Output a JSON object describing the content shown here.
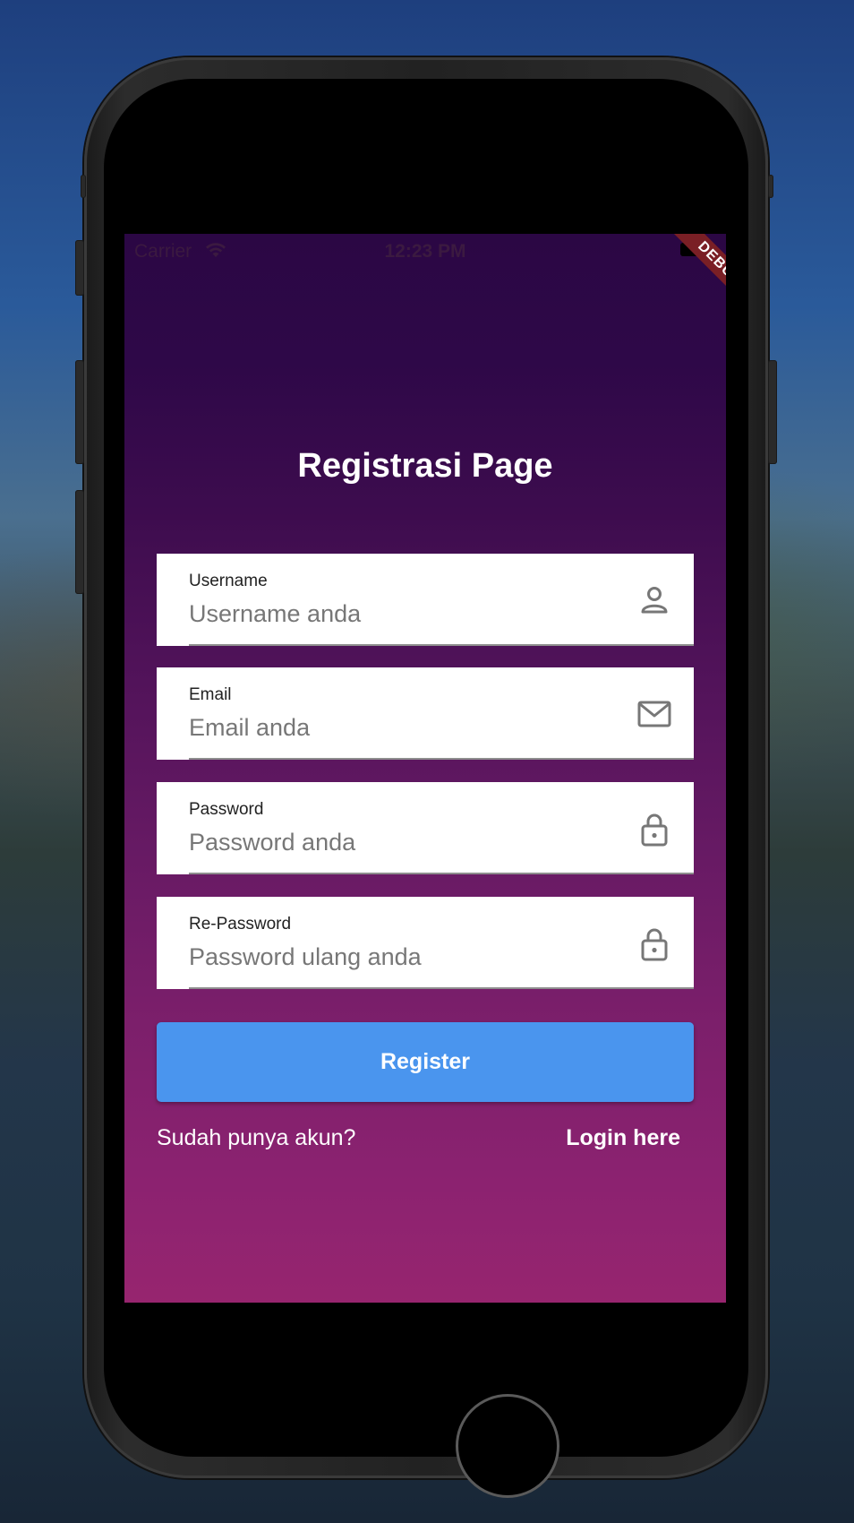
{
  "status_bar": {
    "carrier": "Carrier",
    "time": "12:23 PM"
  },
  "debug_banner": "DEBUG",
  "page": {
    "title": "Registrasi Page"
  },
  "form": {
    "fields": [
      {
        "label": "Username",
        "placeholder": "Username anda",
        "icon": "person-icon"
      },
      {
        "label": "Email",
        "placeholder": "Email anda",
        "icon": "mail-icon"
      },
      {
        "label": "Password",
        "placeholder": "Password anda",
        "icon": "lock-icon"
      },
      {
        "label": "Re-Password",
        "placeholder": "Password ulang anda",
        "icon": "lock-icon"
      }
    ],
    "register_label": "Register",
    "have_account_text": "Sudah punya akun?",
    "login_link_label": "Login here"
  },
  "colors": {
    "accent": "#4a95ee",
    "gradient_top": "#2b0744",
    "gradient_bottom": "#97256f",
    "debug_banner": "#7a1f25"
  }
}
